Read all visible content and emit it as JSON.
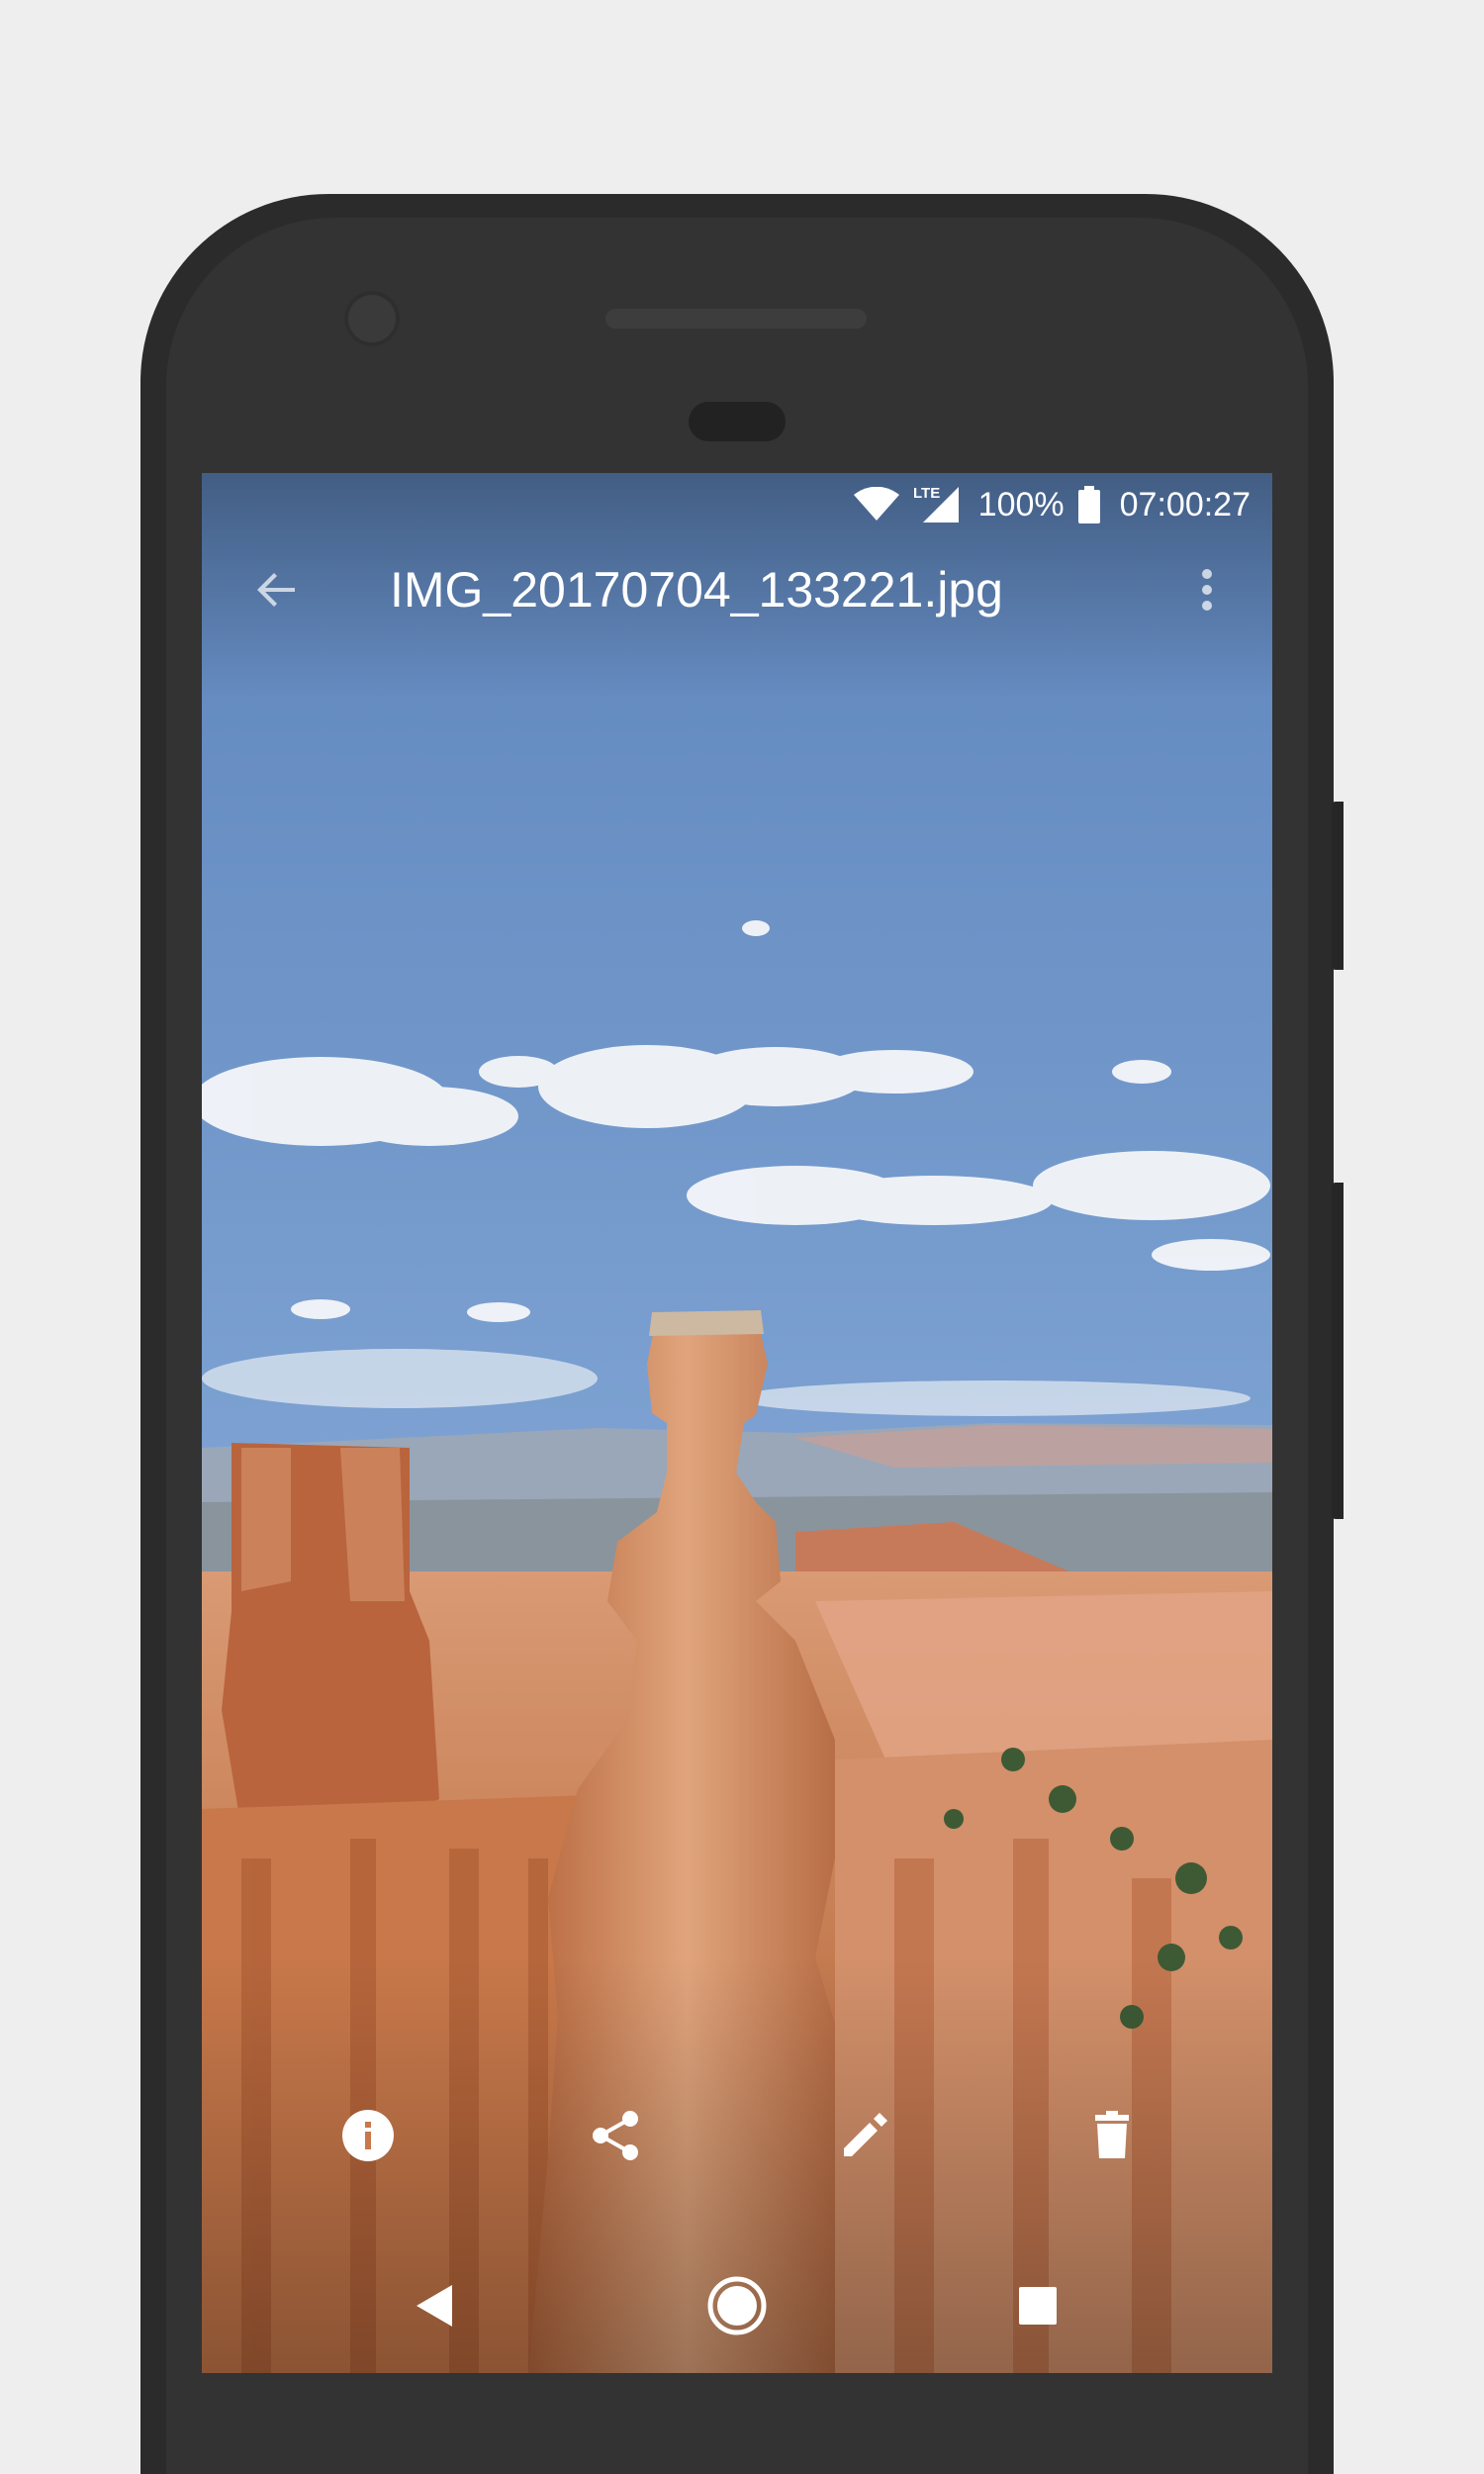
{
  "status_bar": {
    "battery_percent": "100%",
    "time": "07:00:27",
    "network": "LTE",
    "icons": [
      "wifi-icon",
      "signal-icon",
      "battery-icon"
    ]
  },
  "app_bar": {
    "title": "IMG_20170704_133221.jpg",
    "back_icon": "arrow-back-icon",
    "menu_icon": "more-vert-icon"
  },
  "photo_actions": [
    {
      "icon": "info-icon"
    },
    {
      "icon": "share-icon"
    },
    {
      "icon": "edit-icon"
    },
    {
      "icon": "delete-icon"
    }
  ],
  "nav_bar": {
    "icons": [
      "nav-back-icon",
      "nav-home-icon",
      "nav-recents-icon"
    ]
  },
  "colors": {
    "page_background": "#eeeeee",
    "phone_body": "#2b2b2b",
    "sky": "#6f96c8",
    "rock": "#c8784a",
    "icon": "#ffffff"
  }
}
